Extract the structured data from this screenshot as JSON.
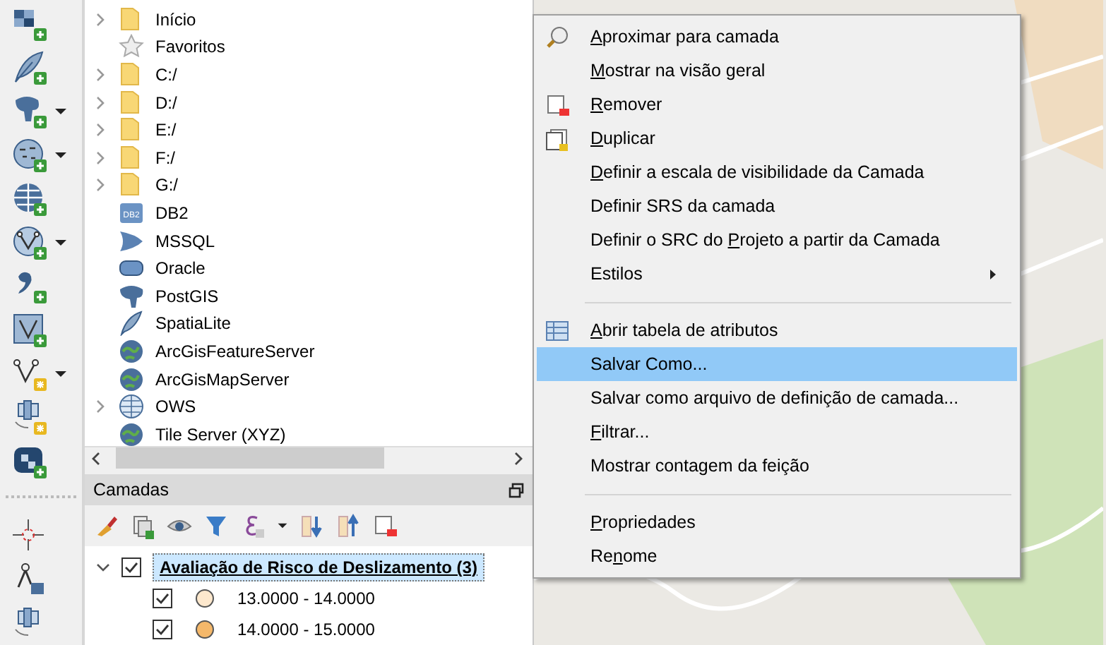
{
  "toolbar": [
    {
      "dropdown": false
    },
    {
      "dropdown": false
    },
    {
      "dropdown": true
    },
    {
      "dropdown": true
    },
    {
      "dropdown": false
    },
    {
      "dropdown": true
    },
    {
      "dropdown": false
    },
    {
      "dropdown": false
    },
    {
      "dropdown": true
    },
    {
      "dropdown": false
    },
    {
      "dropdown": false
    },
    {
      "dropdown": false
    },
    {
      "dropdown": false
    },
    {
      "dropdown": false
    }
  ],
  "browser": {
    "items": [
      {
        "label": "Início",
        "expandable": true
      },
      {
        "label": "Favoritos",
        "expandable": false
      },
      {
        "label": "C:/",
        "expandable": true
      },
      {
        "label": "D:/",
        "expandable": true
      },
      {
        "label": "E:/",
        "expandable": true
      },
      {
        "label": "F:/",
        "expandable": true
      },
      {
        "label": "G:/",
        "expandable": true
      },
      {
        "label": "DB2",
        "icon_text": "DB2",
        "expandable": false
      },
      {
        "label": "MSSQL",
        "expandable": false
      },
      {
        "label": "Oracle",
        "expandable": false
      },
      {
        "label": "PostGIS",
        "expandable": false
      },
      {
        "label": "SpatiaLite",
        "expandable": false
      },
      {
        "label": "ArcGisFeatureServer",
        "expandable": false
      },
      {
        "label": "ArcGisMapServer",
        "expandable": false
      },
      {
        "label": "OWS",
        "expandable": true
      },
      {
        "label": "Tile Server (XYZ)",
        "expandable": false
      }
    ]
  },
  "layers": {
    "title": "Camadas",
    "tree": [
      {
        "label": "Avaliação de Risco de Deslizamento (3)",
        "checked": true,
        "expanded": true,
        "selected": true,
        "children": [
          {
            "label": "13.0000 - 14.0000",
            "checked": true,
            "color": "#fde8cd"
          },
          {
            "label": "14.0000 - 15.0000",
            "checked": true,
            "color": "#f5b86a"
          }
        ]
      }
    ]
  },
  "context_menu": [
    {
      "kind": "item",
      "key": "A",
      "rest": "proximar para camada",
      "selected": false
    },
    {
      "kind": "item",
      "key": "M",
      "rest": "ostrar na visão geral",
      "selected": false
    },
    {
      "kind": "item",
      "key": "R",
      "rest": "emover",
      "selected": false
    },
    {
      "kind": "item",
      "key": "D",
      "rest": "uplicar",
      "selected": false
    },
    {
      "kind": "item",
      "key": "D",
      "rest": "efinir a escala de visibilidade da Camada",
      "selected": false
    },
    {
      "kind": "item",
      "label": "Definir SRS da camada",
      "selected": false
    },
    {
      "kind": "item",
      "lead": "Definir o SRC do ",
      "key": "P",
      "rest": "rojeto a partir da Camada",
      "selected": false
    },
    {
      "kind": "submenu",
      "label": "Estilos",
      "selected": false
    },
    {
      "kind": "separator"
    },
    {
      "kind": "item",
      "key": "A",
      "rest": "brir tabela de atributos",
      "selected": false
    },
    {
      "kind": "item",
      "label": "Salvar Como...",
      "selected": true
    },
    {
      "kind": "item",
      "label": "Salvar como arquivo de definição de camada...",
      "selected": false
    },
    {
      "kind": "item",
      "key": "F",
      "rest": "iltrar...",
      "selected": false
    },
    {
      "kind": "item",
      "label": "Mostrar contagem da feição",
      "selected": false
    },
    {
      "kind": "separator"
    },
    {
      "kind": "item",
      "key": "P",
      "rest": "ropriedades",
      "selected": false
    },
    {
      "kind": "item",
      "lead": "Re",
      "key": "n",
      "rest": "ome",
      "selected": false
    }
  ]
}
